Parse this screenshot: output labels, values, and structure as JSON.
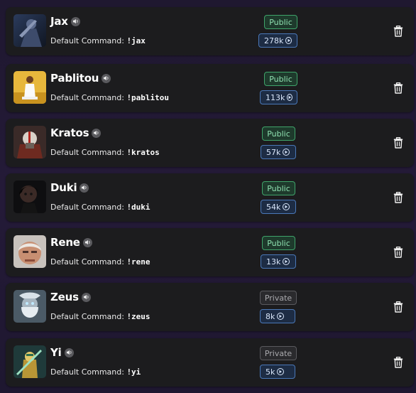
{
  "command_label": "Default Command:",
  "sounds": [
    {
      "name": "Jax",
      "command": "!jax",
      "status": "Public",
      "plays": "278k",
      "avatar": "jax"
    },
    {
      "name": "Pablitou",
      "command": "!pablitou",
      "status": "Public",
      "plays": "113k",
      "avatar": "pablitou"
    },
    {
      "name": "Kratos",
      "command": "!kratos",
      "status": "Public",
      "plays": "57k",
      "avatar": "kratos"
    },
    {
      "name": "Duki",
      "command": "!duki",
      "status": "Public",
      "plays": "54k",
      "avatar": "duki"
    },
    {
      "name": "Rene",
      "command": "!rene",
      "status": "Public",
      "plays": "13k",
      "avatar": "rene"
    },
    {
      "name": "Zeus",
      "command": "!zeus",
      "status": "Private",
      "plays": "8k",
      "avatar": "zeus"
    },
    {
      "name": "Yi",
      "command": "!yi",
      "status": "Private",
      "plays": "5k",
      "avatar": "yi"
    }
  ],
  "icons": {
    "speaker": "speaker-icon",
    "play": "play-circle-icon",
    "delete": "trash-icon"
  },
  "colors": {
    "public_badge": "#3fa46a",
    "private_badge": "#5a5a5e",
    "plays_badge": "#4a78b8",
    "card_background": "#1c1c1e"
  }
}
